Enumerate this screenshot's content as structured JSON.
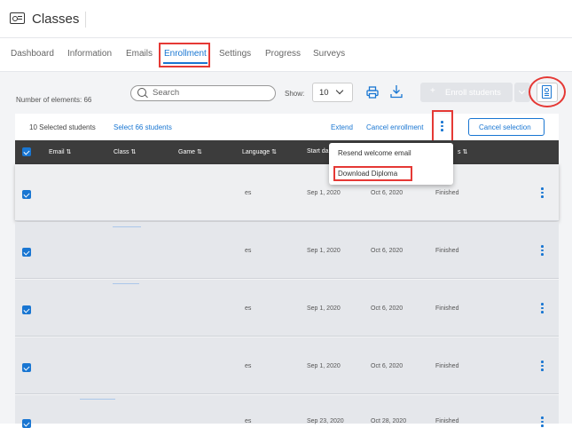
{
  "app": {
    "title": "Classes"
  },
  "tabs": [
    {
      "label": "Dashboard",
      "active": false
    },
    {
      "label": "Information",
      "active": false
    },
    {
      "label": "Emails",
      "active": false
    },
    {
      "label": "Enrollment",
      "active": true
    },
    {
      "label": "Settings",
      "active": false
    },
    {
      "label": "Progress",
      "active": false
    },
    {
      "label": "Surveys",
      "active": false
    }
  ],
  "toolbar": {
    "number_of_elements": "Number of elements: 66",
    "search_placeholder": "Search",
    "show_label": "Show:",
    "show_value": "10",
    "enroll_label": "Enroll students",
    "icons": [
      "print-icon",
      "download-icon",
      "add-user-icon",
      "diploma-icon"
    ]
  },
  "selection_bar": {
    "count": "10 Selected students",
    "select_all": "Select 66 students",
    "extend": "Extend",
    "cancel_enrollment": "Cancel enrollment",
    "cancel_selection": "Cancel selection"
  },
  "table": {
    "columns": [
      "Email",
      "Class",
      "Game",
      "Language",
      "Start da",
      "",
      "s"
    ],
    "rows": [
      {
        "language": "es",
        "start": "Sep 1, 2020",
        "end": "Oct 6, 2020",
        "status": "Finished"
      },
      {
        "language": "es",
        "start": "Sep 1, 2020",
        "end": "Oct 6, 2020",
        "status": "Finished"
      },
      {
        "language": "es",
        "start": "Sep 1, 2020",
        "end": "Oct 6, 2020",
        "status": "Finished"
      },
      {
        "language": "es",
        "start": "Sep 1, 2020",
        "end": "Oct 6, 2020",
        "status": "Finished"
      },
      {
        "language": "es",
        "start": "Sep 23, 2020",
        "end": "Oct 28, 2020",
        "status": "Finished"
      }
    ]
  },
  "menu": {
    "items": [
      "Resend welcome email",
      "Download Diploma"
    ]
  },
  "colors": {
    "accent": "#1976d2",
    "highlight": "#e53935",
    "header": "#3c3c3c"
  }
}
